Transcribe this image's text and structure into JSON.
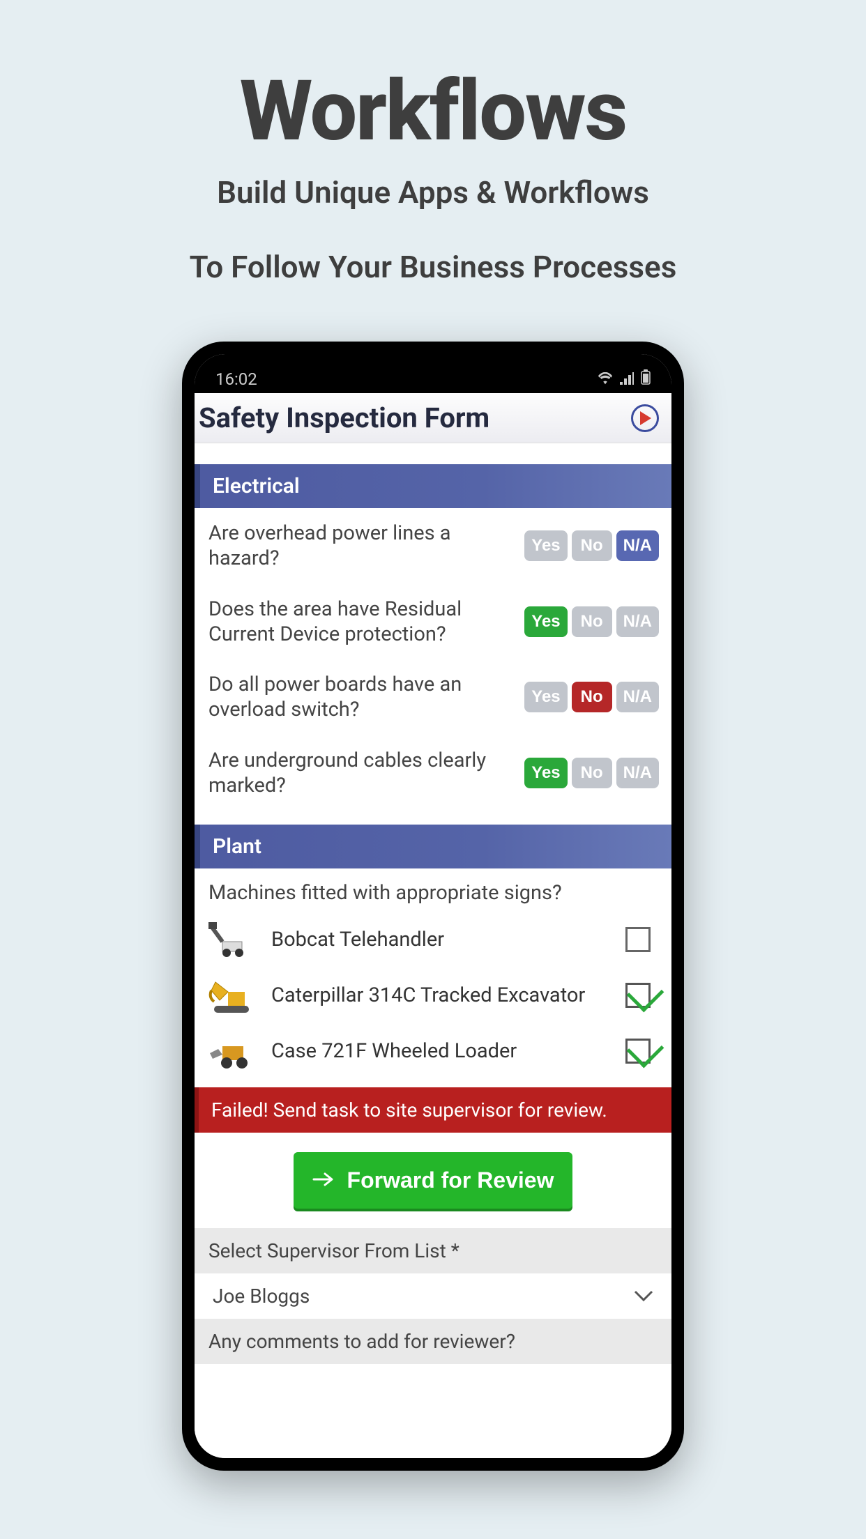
{
  "hero": {
    "title": "Workflows",
    "line1": "Build Unique Apps & Workflows",
    "line2": "To Follow Your Business Processes"
  },
  "status": {
    "time": "16:02"
  },
  "app": {
    "title": "Safety Inspection Form"
  },
  "options": {
    "yes": "Yes",
    "no": "No",
    "na": "N/A"
  },
  "sections": {
    "electrical": {
      "title": "Electrical",
      "q1": {
        "text": "Are overhead power lines a hazard?",
        "selected": "na"
      },
      "q2": {
        "text": "Does the area have Residual Current Device protection?",
        "selected": "yes"
      },
      "q3": {
        "text": "Do all power boards have an overload switch?",
        "selected": "no"
      },
      "q4": {
        "text": "Are underground cables clearly marked?",
        "selected": "yes"
      }
    },
    "plant": {
      "title": "Plant",
      "question": "Machines fitted with appropriate signs?",
      "m1": {
        "name": "Bobcat Telehandler",
        "checked": false
      },
      "m2": {
        "name": "Caterpillar 314C Tracked Excavator",
        "checked": true
      },
      "m3": {
        "name": "Case 721F Wheeled Loader",
        "checked": true
      }
    }
  },
  "fail_banner": "Failed! Send task to site supervisor for review.",
  "forward_button": "Forward for Review",
  "supervisor": {
    "label": "Select Supervisor From List *",
    "selected": "Joe Bloggs"
  },
  "comments_label": "Any comments to add for reviewer?"
}
